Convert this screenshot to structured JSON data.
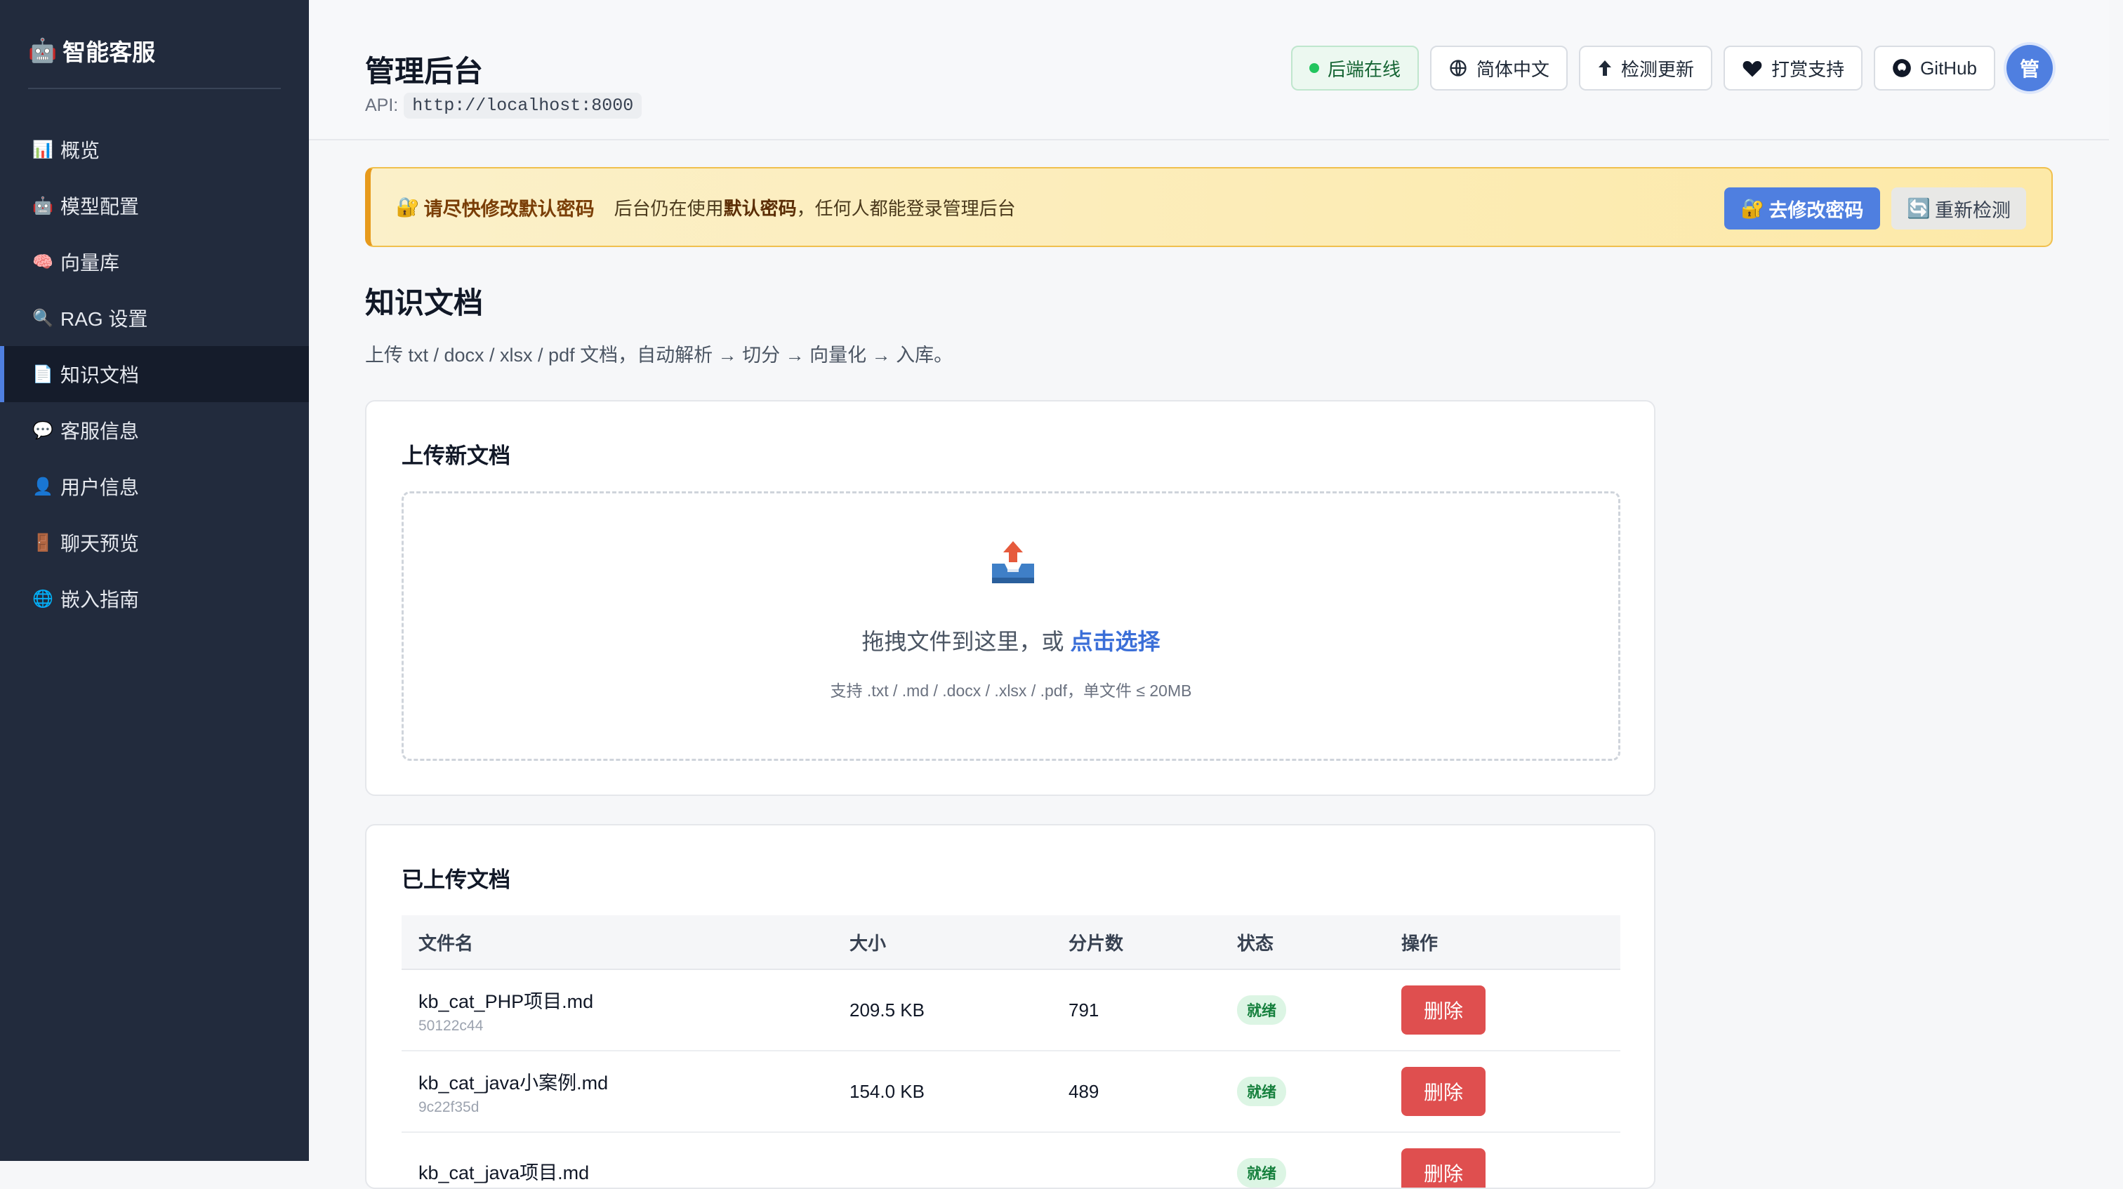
{
  "sidebar": {
    "brand_icon": "robot-icon",
    "brand": "智能客服",
    "items": [
      {
        "icon": "bar-chart-icon",
        "glyph": "📊",
        "label": "概览",
        "active": false
      },
      {
        "icon": "robot-icon",
        "glyph": "🤖",
        "label": "模型配置",
        "active": false
      },
      {
        "icon": "brain-icon",
        "glyph": "🧠",
        "label": "向量库",
        "active": false
      },
      {
        "icon": "magnifier-icon",
        "glyph": "🔍",
        "label": "RAG 设置",
        "active": false
      },
      {
        "icon": "document-icon",
        "glyph": "📄",
        "label": "知识文档",
        "active": true
      },
      {
        "icon": "speech-bubble-icon",
        "glyph": "💬",
        "label": "客服信息",
        "active": false
      },
      {
        "icon": "user-icon",
        "glyph": "👤",
        "label": "用户信息",
        "active": false
      },
      {
        "icon": "door-icon",
        "glyph": "🚪",
        "label": "聊天预览",
        "active": false
      },
      {
        "icon": "globe-icon",
        "glyph": "🌐",
        "label": "嵌入指南",
        "active": false
      }
    ]
  },
  "header": {
    "title": "管理后台",
    "api_label": "API:",
    "api_url": "http://localhost:8000",
    "status": "后端在线",
    "language": "简体中文",
    "check_update": "检测更新",
    "donate": "打赏支持",
    "github": "GitHub",
    "avatar": "管"
  },
  "warning": {
    "title": "请尽快修改默认密码",
    "text_prefix": "后台仍在使用",
    "text_bold": "默认密码",
    "text_suffix": "，任何人都能登录管理后台",
    "change_button": "去修改密码",
    "recheck_button": "重新检测"
  },
  "page": {
    "title": "知识文档",
    "description": "上传 txt / docx / xlsx / pdf 文档，自动解析 → 切分 → 向量化 → 入库。"
  },
  "upload": {
    "title": "上传新文档",
    "drop_text": "拖拽文件到这里，或",
    "drop_link": "点击选择",
    "hint": "支持 .txt / .md / .docx / .xlsx / .pdf，单文件 ≤ 20MB"
  },
  "documents": {
    "title": "已上传文档",
    "columns": [
      "文件名",
      "大小",
      "分片数",
      "状态",
      "操作"
    ],
    "rows": [
      {
        "name": "kb_cat_PHP项目.md",
        "id": "50122c44",
        "size": "209.5 KB",
        "chunks": "791",
        "status": "就绪",
        "action": "删除"
      },
      {
        "name": "kb_cat_java小案例.md",
        "id": "9c22f35d",
        "size": "154.0 KB",
        "chunks": "489",
        "status": "就绪",
        "action": "删除"
      },
      {
        "name": "kb_cat_java项目.md",
        "id": "",
        "size": "",
        "chunks": "",
        "status": "就绪",
        "action": "删除"
      }
    ]
  },
  "colors": {
    "sidebar_bg": "#222b3d",
    "accent": "#4f7fe0",
    "danger": "#df4f4f",
    "success": "#15803d",
    "warning": "#f0c04e"
  }
}
